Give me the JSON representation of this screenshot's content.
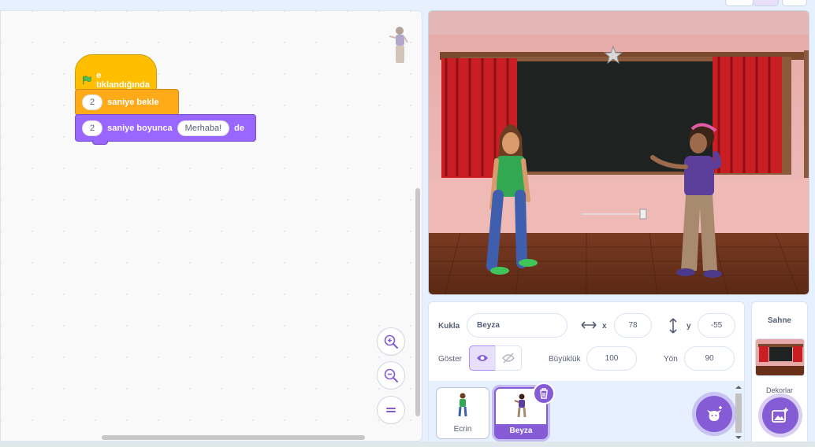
{
  "code": {
    "hat_label": "e tıklandığında",
    "wait": {
      "value": "2",
      "label": "saniye bekle"
    },
    "say": {
      "seconds": "2",
      "label": "saniye boyunca",
      "message": "Merhaba!",
      "suffix": "de"
    }
  },
  "zoom": {
    "in_icon": "zoom-in-icon",
    "out_icon": "zoom-out-icon",
    "reset_icon": "equals-icon"
  },
  "sprite_info": {
    "sprite_label": "Kukla",
    "sprite_name": "Beyza",
    "x_label": "x",
    "x_value": "78",
    "y_label": "y",
    "y_value": "-55",
    "show_label": "Göster",
    "size_label": "Büyüklük",
    "size_value": "100",
    "direction_label": "Yön",
    "direction_value": "90"
  },
  "sprites": [
    {
      "name": "Ecrin",
      "selected": false
    },
    {
      "name": "Beyza",
      "selected": true
    }
  ],
  "stage_pane": {
    "title": "Sahne",
    "backdrops_label": "Dekorlar"
  },
  "colors": {
    "events": "#ffbf00",
    "control": "#ffab19",
    "looks": "#9966ff",
    "accent": "#855cd6"
  }
}
